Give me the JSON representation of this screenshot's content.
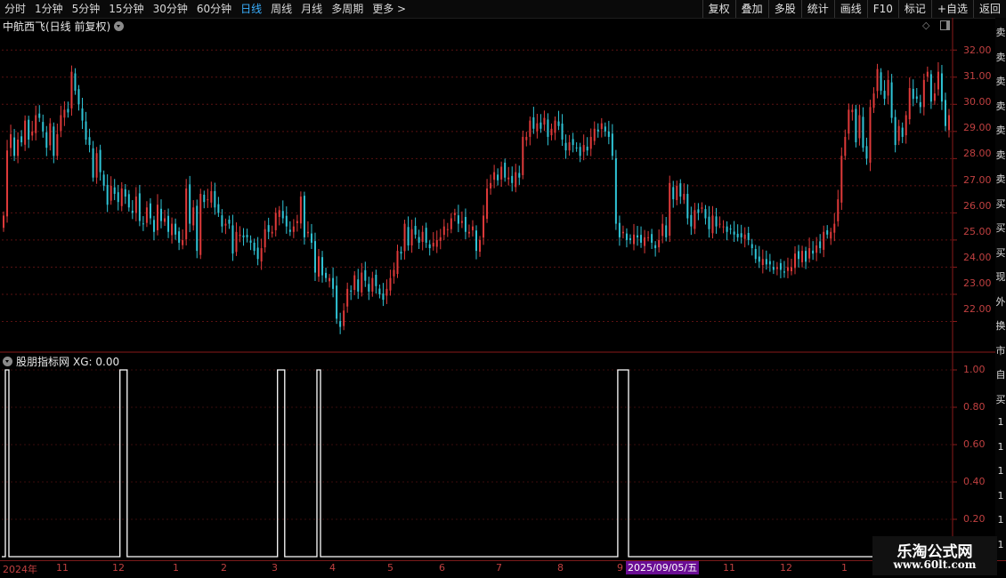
{
  "toolbar": {
    "left_items": [
      "分时",
      "1分钟",
      "5分钟",
      "15分钟",
      "30分钟",
      "60分钟",
      "日线",
      "周线",
      "月线",
      "多周期",
      "更多 >"
    ],
    "active_index": 6,
    "right_items": [
      "复权",
      "叠加",
      "多股",
      "统计",
      "画线",
      "F10",
      "标记",
      "+自选",
      "返回"
    ]
  },
  "main_pane": {
    "title": "中航西飞(日线 前复权)",
    "price_axis": [
      "32.00",
      "31.00",
      "30.00",
      "29.00",
      "28.00",
      "27.00",
      "26.00",
      "25.00",
      "24.00",
      "23.00",
      "22.00"
    ]
  },
  "indicator_pane": {
    "name": "股朋指标网",
    "value_text": "XG: 0.00",
    "axis": [
      "1.00",
      "0.80",
      "0.60",
      "0.40",
      "0.20"
    ]
  },
  "date_axis": {
    "labels": [
      "2024年",
      "11",
      "12",
      "1",
      "2",
      "3",
      "4",
      "5",
      "6",
      "7",
      "8",
      "9",
      "11",
      "12",
      "1"
    ],
    "current": "2025/09/05/五"
  },
  "side_strip_chars": [
    "卖",
    "卖",
    "卖",
    "卖",
    "卖",
    "卖",
    "卖",
    "买",
    "买",
    "买",
    "现",
    "外",
    "换",
    "市",
    "自",
    "买",
    "1",
    "1",
    "1",
    "1",
    "1",
    "1"
  ],
  "watermark": {
    "title": "乐淘公式网",
    "url": "www.60lt.com"
  },
  "chart_data": {
    "type": "candlestick",
    "ylim": [
      21.0,
      32.5
    ],
    "indicator_ylim": [
      0,
      1
    ],
    "closes": [
      25.9,
      28.3,
      28.9,
      28.1,
      28.7,
      28.6,
      29.4,
      28.7,
      29.0,
      29.6,
      29.5,
      29.0,
      28.4,
      29.3,
      28.1,
      28.9,
      29.6,
      29.8,
      29.7,
      31.2,
      30.5,
      30.0,
      29.4,
      28.7,
      28.5,
      27.3,
      28.2,
      27.5,
      27.0,
      26.3,
      27.0,
      26.7,
      26.4,
      26.9,
      26.6,
      26.2,
      26.0,
      26.6,
      25.7,
      25.6,
      26.2,
      25.8,
      25.3,
      26.3,
      25.7,
      25.8,
      25.3,
      25.6,
      25.2,
      24.9,
      25.0,
      26.9,
      25.6,
      26.2,
      24.6,
      26.7,
      26.4,
      26.5,
      26.8,
      26.2,
      26.0,
      25.5,
      25.6,
      25.6,
      24.5,
      25.3,
      25.2,
      25.1,
      25.1,
      24.9,
      24.6,
      24.3,
      24.7,
      25.4,
      25.3,
      25.3,
      26.0,
      26.1,
      25.8,
      25.5,
      25.3,
      25.5,
      25.7,
      26.6,
      25.1,
      25.3,
      24.9,
      23.8,
      24.4,
      23.7,
      23.6,
      23.6,
      23.2,
      22.1,
      21.8,
      22.4,
      23.2,
      23.1,
      23.7,
      23.1,
      23.8,
      23.5,
      23.1,
      23.6,
      23.3,
      23.0,
      22.8,
      23.2,
      23.6,
      23.9,
      24.6,
      24.5,
      25.6,
      24.8,
      25.4,
      25.2,
      24.9,
      25.3,
      24.9,
      24.7,
      24.9,
      25.0,
      25.1,
      25.5,
      25.4,
      25.8,
      26.0,
      25.6,
      25.7,
      25.3,
      25.3,
      25.5,
      24.6,
      25.0,
      25.9,
      26.9,
      27.1,
      27.5,
      27.2,
      27.7,
      27.3,
      27.3,
      27.1,
      27.5,
      27.3,
      28.8,
      28.8,
      29.4,
      29.1,
      29.3,
      29.1,
      29.5,
      28.8,
      29.1,
      29.4,
      29.2,
      28.7,
      28.3,
      28.6,
      28.5,
      28.4,
      28.1,
      28.5,
      28.3,
      28.8,
      29.1,
      29.0,
      29.3,
      29.0,
      28.8,
      28.1,
      25.6,
      25.1,
      25.3,
      25.0,
      25.0,
      25.2,
      25.1,
      24.9,
      25.1,
      25.1,
      24.9,
      24.7,
      25.0,
      25.6,
      25.1,
      27.1,
      26.5,
      27.0,
      26.6,
      26.7,
      25.8,
      25.5,
      26.1,
      26.0,
      26.2,
      25.8,
      25.4,
      25.9,
      25.5,
      25.6,
      25.5,
      25.3,
      25.4,
      25.2,
      25.1,
      25.1,
      25.2,
      25.0,
      24.7,
      24.3,
      24.2,
      24.3,
      24.1,
      24.1,
      23.9,
      24.0,
      23.9,
      23.8,
      24.0,
      24.0,
      24.5,
      24.3,
      24.6,
      24.2,
      24.7,
      24.5,
      24.8,
      24.7,
      25.3,
      25.2,
      25.3,
      25.6,
      26.5,
      28.1,
      28.8,
      29.8,
      29.8,
      28.6,
      29.6,
      28.4,
      28.0,
      29.9,
      30.4,
      31.3,
      30.5,
      30.2,
      30.9,
      29.5,
      28.5,
      29.2,
      28.8,
      29.6,
      30.6,
      30.2,
      30.2,
      29.9,
      30.9,
      31.2,
      30.1,
      30.4,
      31.2,
      30.1,
      29.2,
      29.6
    ],
    "signals": [
      1,
      33,
      34,
      77,
      78,
      88,
      172,
      173,
      174
    ]
  }
}
